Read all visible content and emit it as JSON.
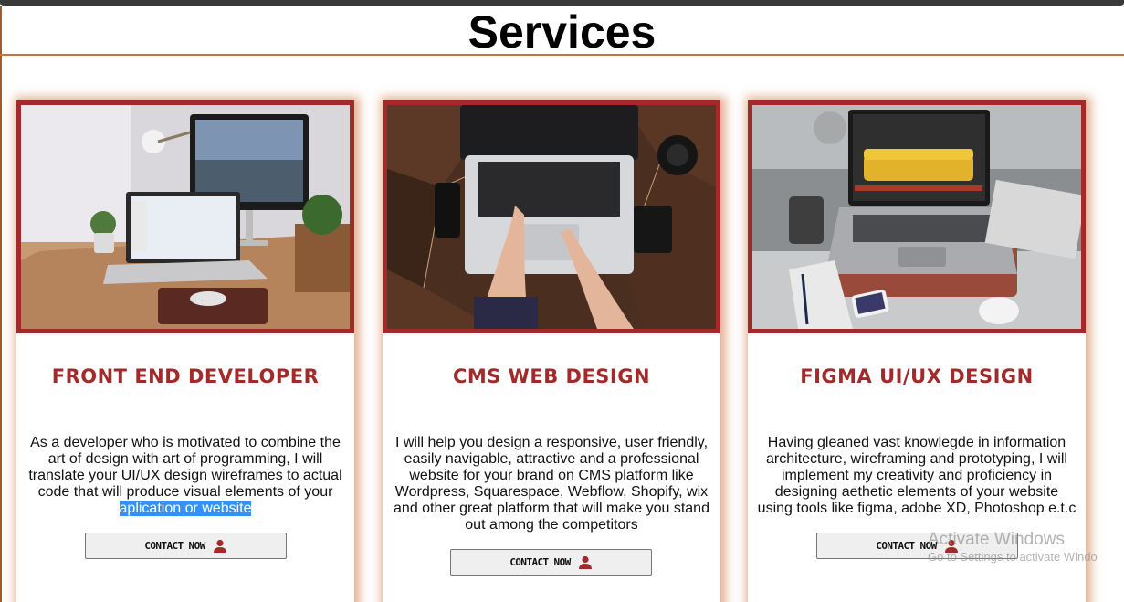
{
  "page": {
    "title": "Services"
  },
  "cards": [
    {
      "image_alt": "desk-setup-photo",
      "title": "FRONT END DEVELOPER",
      "description_main": "As a developer who is motivated to combine the art of design with art of programming, I will translate your UI/UX design wireframes to actual code that will produce visual elements of your ",
      "description_selected": "aplication or website",
      "button_label": "CONTACT NOW",
      "button_icon": "user-icon"
    },
    {
      "image_alt": "laptop-typing-photo",
      "title": "CMS WEB DESIGN",
      "description_main": "I will help you design a responsive, user friendly, easily navigable, attractive and a professional website for your brand on CMS platform like Wordpress, Squarespace, Webflow, Shopify, wix and other great platform that will make you stand out among the competitors",
      "description_selected": "",
      "button_label": "CONTACT NOW",
      "button_icon": "user-icon"
    },
    {
      "image_alt": "laptop-design-photo",
      "title": "FIGMA UI/UX DESIGN",
      "description_main": "Having gleaned vast knowlegde in information architecture, wireframing and prototyping, I will implement my creativity and proficiency in designing aethetic elements of your website using tools like figma, adobe XD, Photoshop e.t.c",
      "description_selected": "",
      "button_label": "CONTACT NOW",
      "button_icon": "user-icon"
    }
  ],
  "watermark": {
    "title": "Activate Windows",
    "subtitle": "Go to Settings to activate Windo"
  },
  "colors": {
    "accent": "#a12a2a",
    "card_shadow": "#cd6e37",
    "selection": "#3390ff"
  }
}
